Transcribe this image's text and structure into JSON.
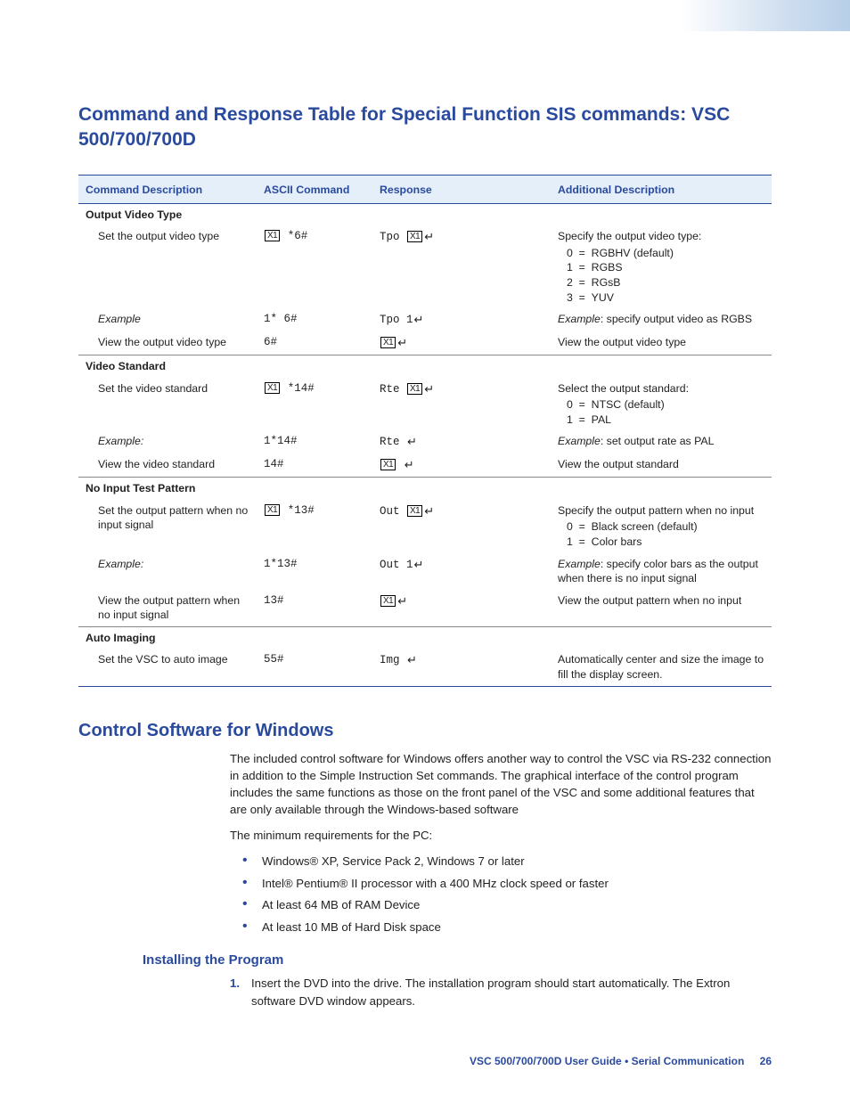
{
  "heading1": "Command and Response Table for Special Function SIS commands: VSC 500/700/700D",
  "table": {
    "headers": [
      "Command Description",
      "ASCII Command",
      "Response",
      "Additional Description"
    ],
    "groups": [
      {
        "name": "Output Video Type",
        "rows": [
          {
            "desc": "Set the output video type",
            "ascii": "[X1] *6#",
            "resp": "Tpo [X1]↵",
            "add": "Specify the output video type:",
            "opts": [
              "0  =  RGBHV (default)",
              "1  =  RGBS",
              "2  =  RGsB",
              "3  =  YUV"
            ]
          },
          {
            "desc": "Example",
            "desc_style": "italic",
            "ascii": "1* 6#",
            "resp": "Tpo 1↵",
            "add_prefix": "Example",
            "add": ": specify output video as RGBS"
          },
          {
            "desc": "View the output video type",
            "ascii": "6#",
            "resp": "[X1]↵",
            "add": "View the output video type",
            "sep": true
          }
        ]
      },
      {
        "name": "Video Standard",
        "rows": [
          {
            "desc": "Set the video standard",
            "ascii": "[X1] *14#",
            "resp": "Rte [X1]↵",
            "add": "Select the output standard:",
            "opts": [
              "0  =  NTSC (default)",
              "1  =  PAL"
            ]
          },
          {
            "desc": "Example:",
            "desc_style": "italic",
            "ascii": "1*14#",
            "resp": "Rte ↵",
            "add_prefix": "Example",
            "add": ": set output rate as PAL"
          },
          {
            "desc": "View the video standard",
            "ascii": "14#",
            "resp": "[X1] ↵",
            "add": "View the output standard",
            "sep": true
          }
        ]
      },
      {
        "name": "No Input Test Pattern",
        "rows": [
          {
            "desc": "Set the output pattern when no input signal",
            "ascii": "[X1] *13#",
            "resp": "Out [X1]↵",
            "add": "Specify the output pattern when no input",
            "opts": [
              "0  =  Black screen (default)",
              "1  =  Color bars"
            ]
          },
          {
            "desc": "Example:",
            "desc_style": "italic",
            "ascii": "1*13#",
            "resp": "Out 1↵",
            "add_prefix": "Example",
            "add": ": specify color bars as the output when there is no input signal"
          },
          {
            "desc": "View the output pattern when no input signal",
            "ascii": "13#",
            "resp": "[X1]↵",
            "add": "View the output pattern when no input",
            "sep": true
          }
        ]
      },
      {
        "name": "Auto Imaging",
        "rows": [
          {
            "desc": "Set the VSC to auto image",
            "ascii": "55#",
            "resp": "Img ↵",
            "add": "Automatically center and size the image to fill the display screen.",
            "lastsep": true
          }
        ]
      }
    ]
  },
  "heading2": "Control Software for Windows",
  "para1": "The included control software for Windows offers another way to control the VSC via RS-232 connection in addition to the Simple Instruction Set commands. The graphical interface of the control program includes the same functions as those on the front panel of the VSC and some additional features that are only available through the Windows-based software",
  "para2": "The minimum requirements for the PC:",
  "bullets": [
    "Windows® XP, Service Pack 2, Windows 7 or later",
    "Intel® Pentium® II processor with a 400 MHz clock speed or faster",
    "At least 64 MB of RAM Device",
    "At least 10 MB of Hard Disk space"
  ],
  "heading3": "Installing the Program",
  "step1": "Insert the DVD into the drive. The installation program should start automatically. The Extron software DVD window appears.",
  "footer": {
    "text": "VSC 500/700/700D User Guide • Serial Communication",
    "page": "26"
  }
}
